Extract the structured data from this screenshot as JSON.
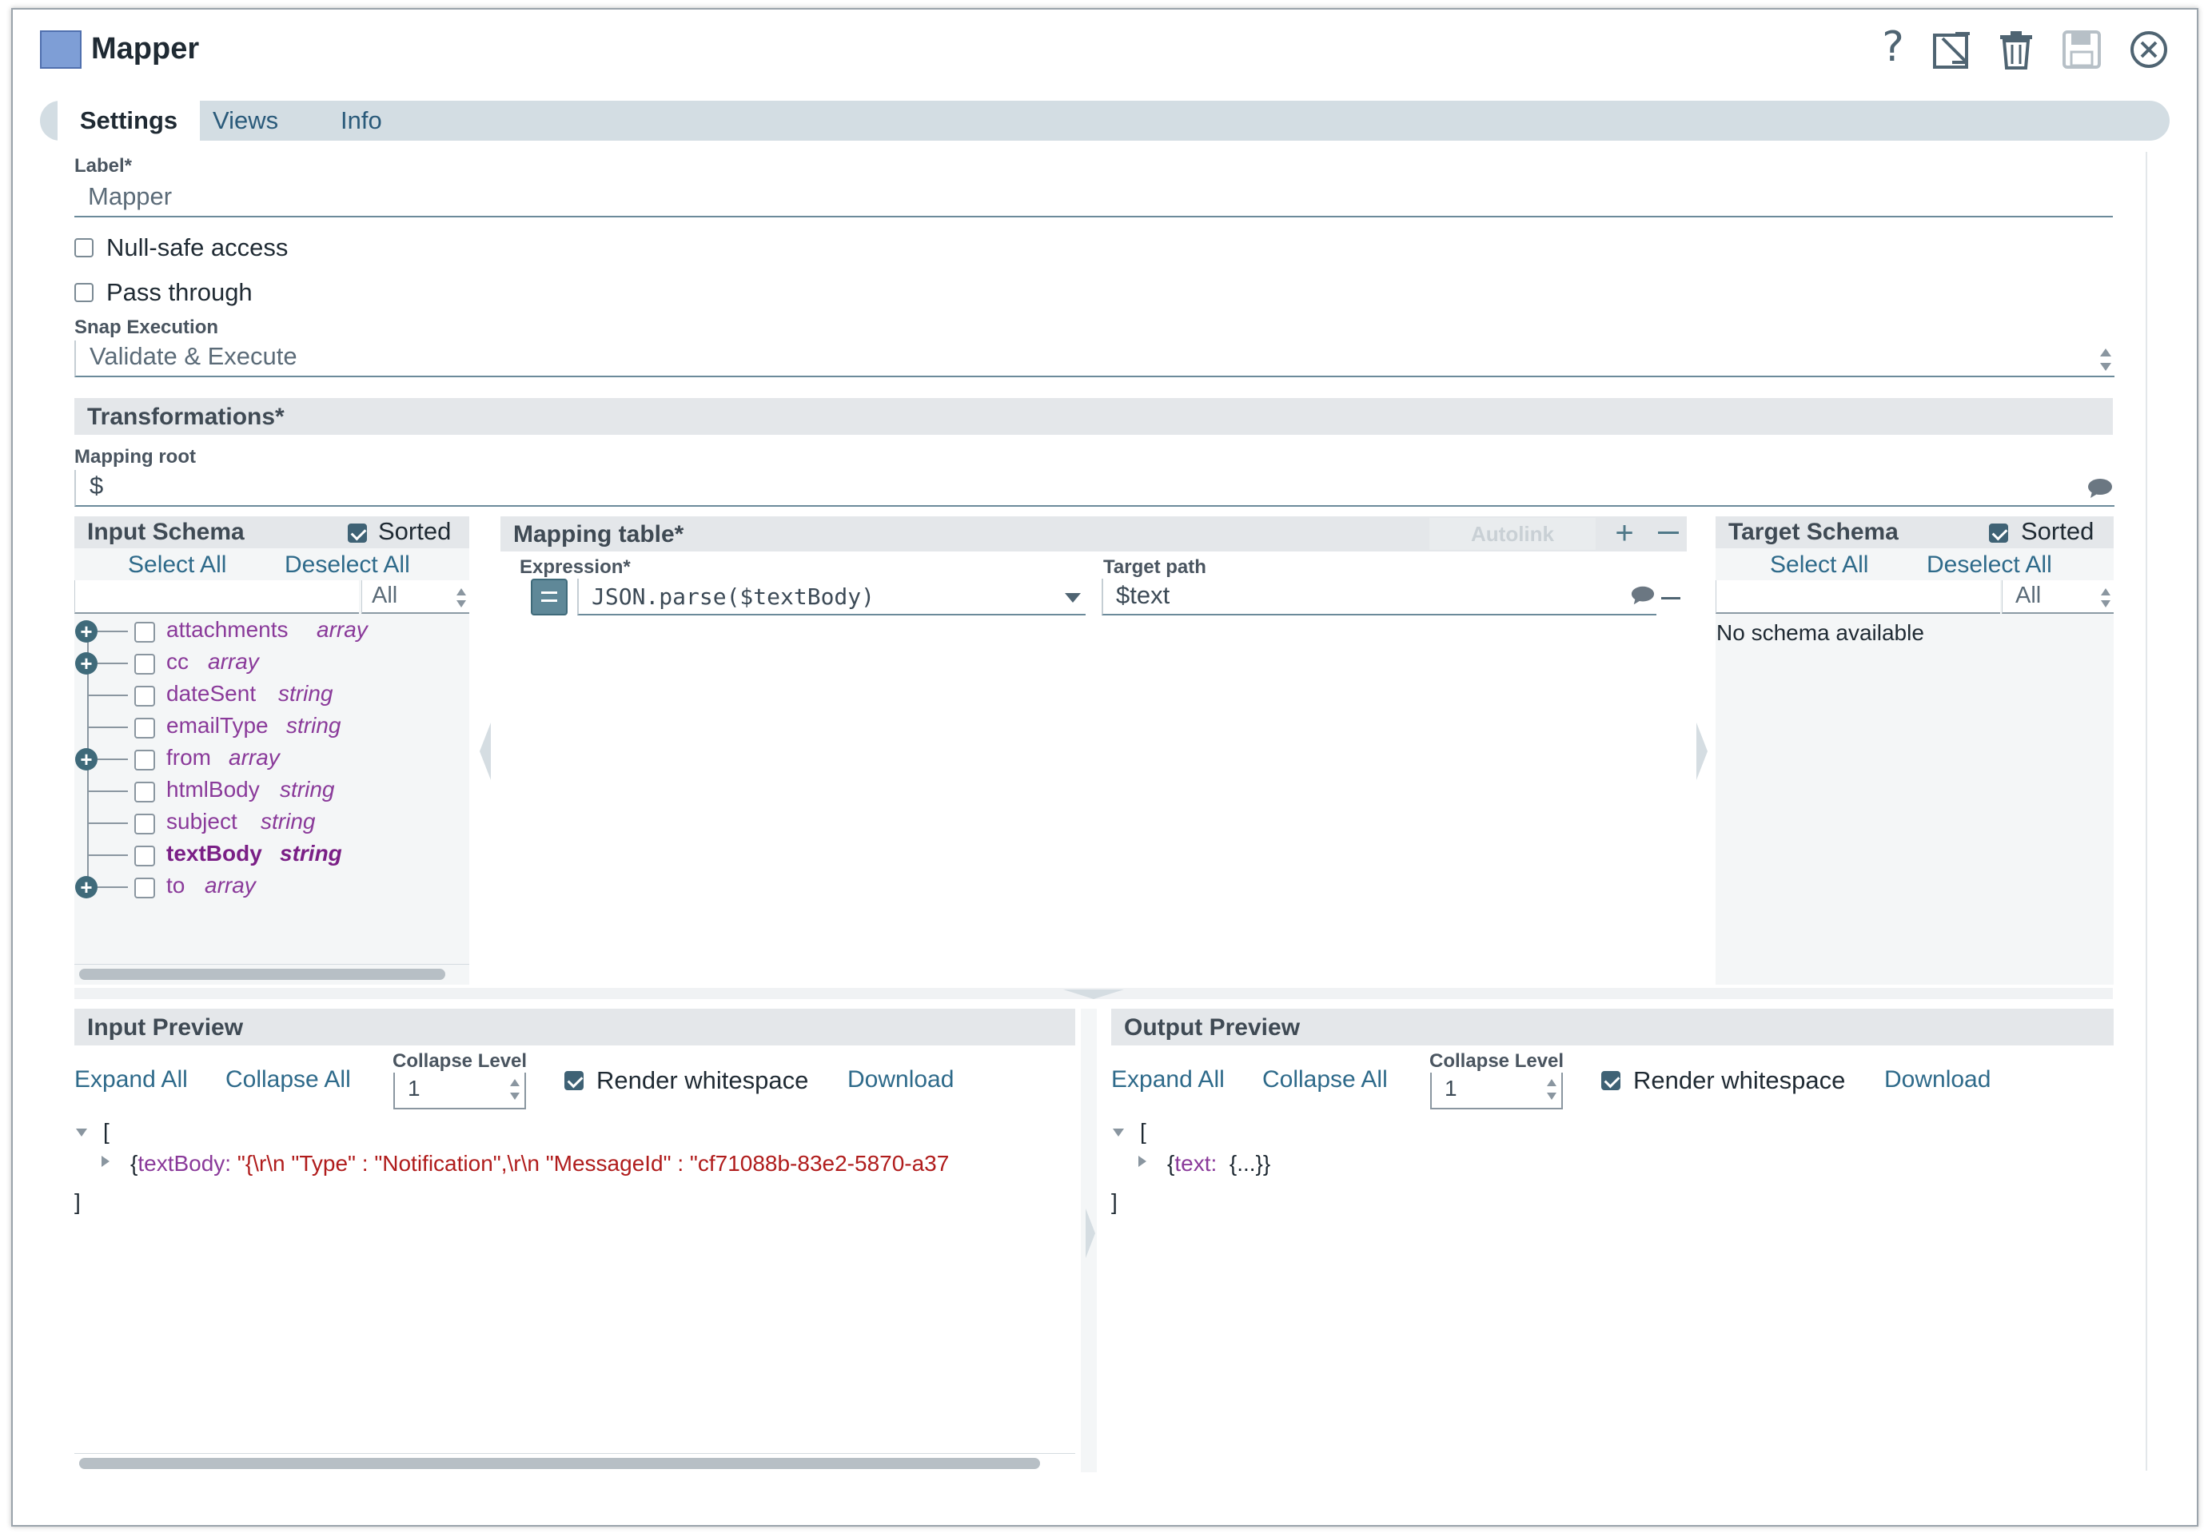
{
  "window": {
    "title": "Mapper",
    "icons": [
      "help-icon",
      "export-icon",
      "trash-icon",
      "save-icon",
      "close-icon"
    ]
  },
  "tabs": [
    {
      "label": "Settings",
      "active": true
    },
    {
      "label": "Views",
      "active": false
    },
    {
      "label": "Info",
      "active": false
    }
  ],
  "settings": {
    "label_caption": "Label*",
    "label_value": "Mapper",
    "null_safe_label": "Null-safe access",
    "null_safe_checked": false,
    "pass_through_label": "Pass through",
    "pass_through_checked": false,
    "snap_execution_caption": "Snap Execution",
    "snap_execution_value": "Validate & Execute"
  },
  "transformations": {
    "title": "Transformations*",
    "mapping_root_caption": "Mapping root",
    "mapping_root_value": "$"
  },
  "input_schema": {
    "title": "Input Schema",
    "sorted_label": "Sorted",
    "sorted_checked": true,
    "select_all": "Select All",
    "deselect_all": "Deselect All",
    "filter_value": "All",
    "fields": [
      {
        "name": "attachments",
        "type": "array",
        "expandable": true,
        "bold": false
      },
      {
        "name": "cc",
        "type": "array",
        "expandable": true,
        "bold": false
      },
      {
        "name": "dateSent",
        "type": "string",
        "expandable": false,
        "bold": false
      },
      {
        "name": "emailType",
        "type": "string",
        "expandable": false,
        "bold": false
      },
      {
        "name": "from",
        "type": "array",
        "expandable": true,
        "bold": false
      },
      {
        "name": "htmlBody",
        "type": "string",
        "expandable": false,
        "bold": false
      },
      {
        "name": "subject",
        "type": "string",
        "expandable": false,
        "bold": false
      },
      {
        "name": "textBody",
        "type": "string",
        "expandable": false,
        "bold": true
      },
      {
        "name": "to",
        "type": "array",
        "expandable": true,
        "bold": false
      }
    ]
  },
  "mapping_table": {
    "title": "Mapping table*",
    "autolink_label": "Autolink",
    "expression_caption": "Expression*",
    "target_caption": "Target path",
    "rows": [
      {
        "expression": "JSON.parse($textBody)",
        "target": "$text"
      }
    ]
  },
  "target_schema": {
    "title": "Target Schema",
    "sorted_label": "Sorted",
    "sorted_checked": true,
    "select_all": "Select All",
    "deselect_all": "Deselect All",
    "filter_value": "All",
    "empty_message": "No schema available"
  },
  "input_preview": {
    "title": "Input Preview",
    "expand_all": "Expand All",
    "collapse_all": "Collapse All",
    "collapse_level_caption": "Collapse Level",
    "collapse_level_value": "1",
    "render_whitespace_label": "Render whitespace",
    "render_whitespace_checked": true,
    "download": "Download",
    "open_bracket": "[",
    "close_bracket": "]",
    "row_key": "textBody:",
    "row_value": "\"{\\r\\n  \"Type\" : \"Notification\",\\r\\n  \"MessageId\" : \"cf71088b-83e2-5870-a37"
  },
  "output_preview": {
    "title": "Output Preview",
    "expand_all": "Expand All",
    "collapse_all": "Collapse All",
    "collapse_level_caption": "Collapse Level",
    "collapse_level_value": "1",
    "render_whitespace_label": "Render whitespace",
    "render_whitespace_checked": true,
    "download": "Download",
    "open_bracket": "[",
    "close_bracket": "]",
    "row_key": "text:",
    "row_value": "{...}}"
  },
  "colors": {
    "accent": "#2e6a8a",
    "schema_field": "#8a3a9a",
    "json_string": "#b01c1c",
    "tab_bar": "#d3dde3"
  }
}
